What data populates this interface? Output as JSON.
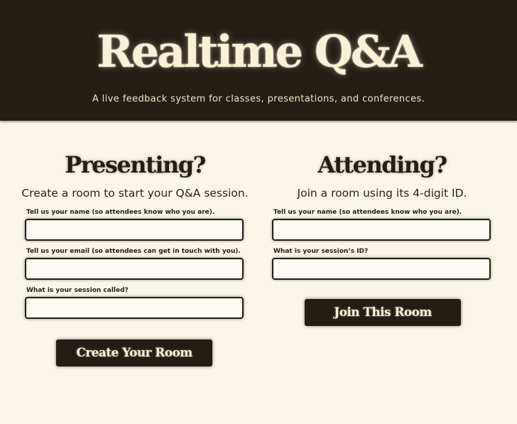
{
  "header": {
    "title": "Realtime Q&A",
    "tagline": "A live feedback system for classes, presentations, and conferences."
  },
  "presenting": {
    "heading": "Presenting?",
    "lead": "Create a room to start your Q&A session.",
    "fields": [
      {
        "label": "Tell us your name (so attendees know who you are).",
        "value": ""
      },
      {
        "label": "Tell us your email (so attendees can get in touch with you).",
        "value": ""
      },
      {
        "label": "What is your session called?",
        "value": ""
      }
    ],
    "button_label": "Create Your Room"
  },
  "attending": {
    "heading": "Attending?",
    "lead": "Join a room using its 4-digit ID.",
    "fields": [
      {
        "label": "Tell us your name (so attendees know who you are).",
        "value": ""
      },
      {
        "label": "What is your session’s ID?",
        "value": ""
      }
    ],
    "button_label": "Join This Room"
  },
  "colors": {
    "dark": "#231d15",
    "cream": "#fbf7e8",
    "title_text": "#f8f1d8"
  }
}
